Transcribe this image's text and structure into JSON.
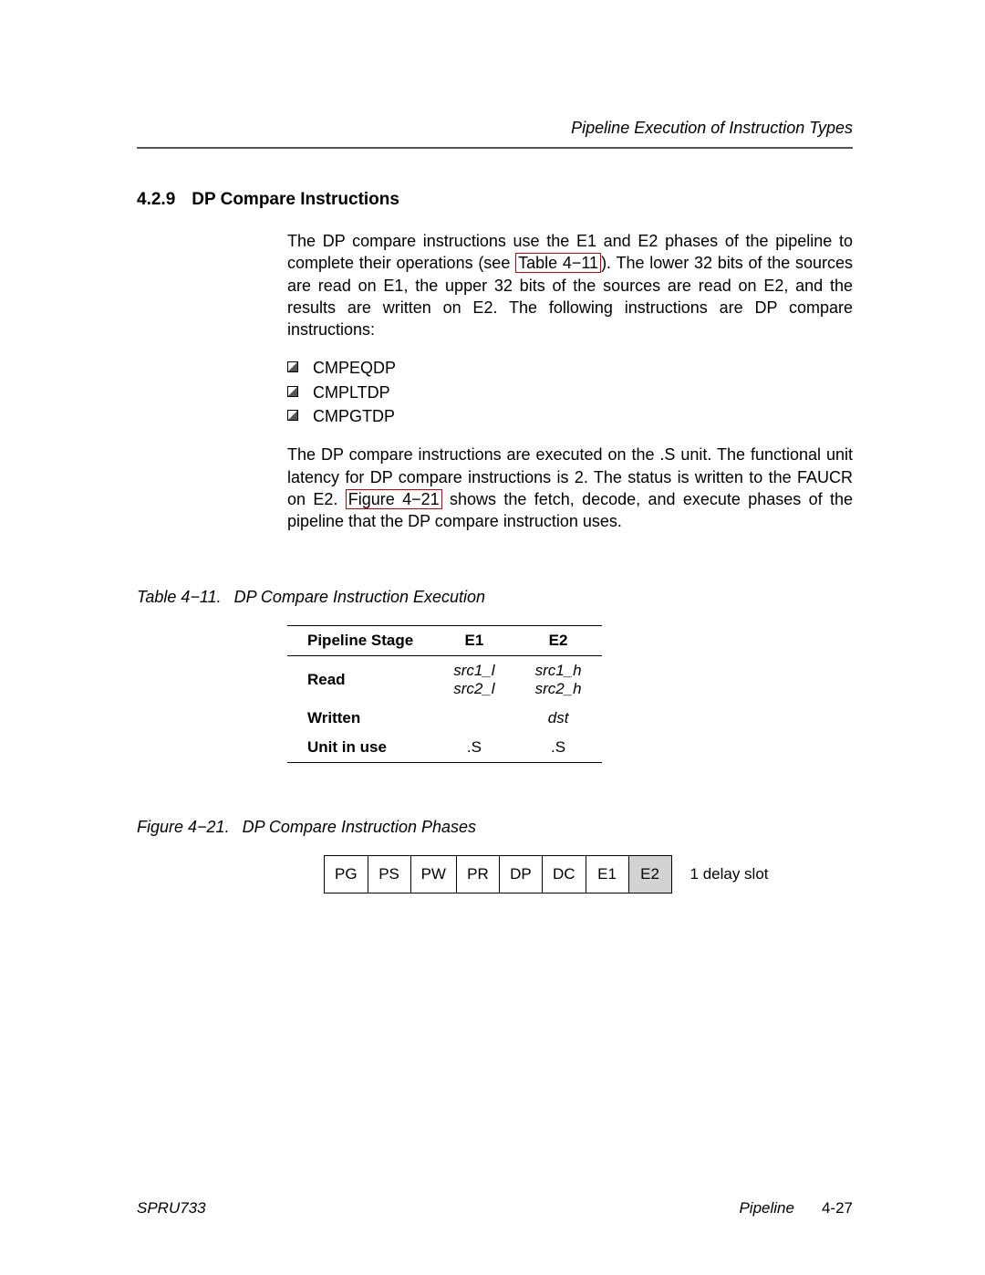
{
  "running_header": "Pipeline Execution of Instruction Types",
  "section": {
    "number": "4.2.9",
    "title": "DP Compare Instructions"
  },
  "para1_a": "The DP compare instructions use the E1 and E2 phases of the pipeline to complete their operations (see ",
  "para1_link": "Table 4−11",
  "para1_b": "). The lower 32 bits of the sources are read on E1, the upper 32 bits of the sources are read on E2, and the results are written on E2. The following instructions are DP compare instructions:",
  "bullets": [
    "CMPEQDP",
    "CMPLTDP",
    "CMPGTDP"
  ],
  "para2_a": "The DP compare instructions are executed on the .S unit. The functional unit latency for DP compare instructions is 2. The status is written to the FAUCR on E2. ",
  "para2_link": "Figure 4−21",
  "para2_b": " shows the fetch, decode, and execute phases of the pipe­line that the DP compare instruction uses.",
  "table_caption": {
    "prefix": "Table 4−11.",
    "text": "DP Compare Instruction Execution"
  },
  "exec_table": {
    "headers": [
      "Pipeline Stage",
      "E1",
      "E2"
    ],
    "rows": [
      {
        "label": "Read",
        "e1": [
          "src1_l",
          "src2_l"
        ],
        "e2": [
          "src1_h",
          "src2_h"
        ]
      },
      {
        "label": "Written",
        "e1": [],
        "e2": [
          "dst"
        ]
      },
      {
        "label": "Unit in use",
        "e1": [
          ".S"
        ],
        "e2": [
          ".S"
        ]
      }
    ]
  },
  "figure_caption": {
    "prefix": "Figure 4−21.",
    "text": "DP Compare Instruction Phases"
  },
  "phases": [
    "PG",
    "PS",
    "PW",
    "PR",
    "DP",
    "DC",
    "E1",
    "E2"
  ],
  "phase_shaded_index": 7,
  "phase_note": "1 delay slot",
  "footer": {
    "left": "SPRU733",
    "right_label": "Pipeline",
    "page": "4-27"
  }
}
